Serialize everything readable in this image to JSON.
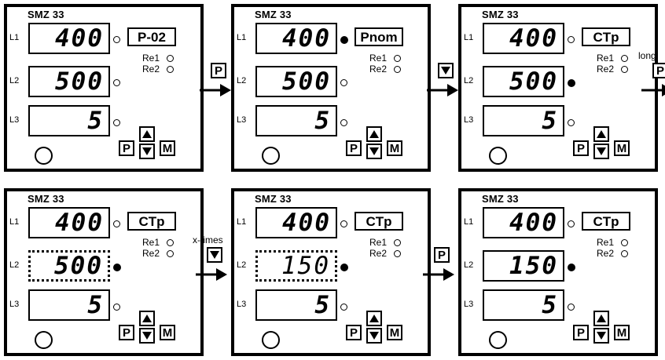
{
  "panels": [
    {
      "model": "SMZ 33",
      "rows": [
        {
          "label": "L1",
          "value": "400",
          "led": false
        },
        {
          "label": "L2",
          "value": "500",
          "led": false
        },
        {
          "label": "L3",
          "value": "5",
          "led": false
        }
      ],
      "param": "P-02",
      "relay1": "Re1",
      "relay2": "Re2",
      "keys": {
        "p": "P",
        "m": "M"
      }
    },
    {
      "model": "SMZ 33",
      "rows": [
        {
          "label": "L1",
          "value": "400",
          "led": true
        },
        {
          "label": "L2",
          "value": "500",
          "led": false
        },
        {
          "label": "L3",
          "value": "5",
          "led": false
        }
      ],
      "param": "Pnom",
      "relay1": "Re1",
      "relay2": "Re2",
      "keys": {
        "p": "P",
        "m": "M"
      }
    },
    {
      "model": "SMZ 33",
      "rows": [
        {
          "label": "L1",
          "value": "400",
          "led": false
        },
        {
          "label": "L2",
          "value": "500",
          "led": true
        },
        {
          "label": "L3",
          "value": "5",
          "led": false
        }
      ],
      "param": "CTp",
      "relay1": "Re1",
      "relay2": "Re2",
      "keys": {
        "p": "P",
        "m": "M"
      }
    },
    {
      "model": "SMZ 33",
      "rows": [
        {
          "label": "L1",
          "value": "400",
          "led": false
        },
        {
          "label": "L2",
          "value": "500",
          "led": true,
          "editing": true
        },
        {
          "label": "L3",
          "value": "5",
          "led": false
        }
      ],
      "param": "CTp",
      "relay1": "Re1",
      "relay2": "Re2",
      "keys": {
        "p": "P",
        "m": "M"
      }
    },
    {
      "model": "SMZ 33",
      "rows": [
        {
          "label": "L1",
          "value": "400",
          "led": false
        },
        {
          "label": "L2",
          "value": "150",
          "led": true,
          "editing": true
        },
        {
          "label": "L3",
          "value": "5",
          "led": false
        }
      ],
      "param": "CTp",
      "relay1": "Re1",
      "relay2": "Re2",
      "keys": {
        "p": "P",
        "m": "M"
      }
    },
    {
      "model": "SMZ 33",
      "rows": [
        {
          "label": "L1",
          "value": "400",
          "led": false
        },
        {
          "label": "L2",
          "value": "150",
          "led": true
        },
        {
          "label": "L3",
          "value": "5",
          "led": false
        }
      ],
      "param": "CTp",
      "relay1": "Re1",
      "relay2": "Re2",
      "keys": {
        "p": "P",
        "m": "M"
      }
    }
  ],
  "transitions": [
    {
      "caption": "",
      "key": "P",
      "key_icon": "p-key"
    },
    {
      "caption": "",
      "key": "",
      "key_icon": "down-arrow-key"
    },
    {
      "caption": "long",
      "key": "P",
      "key_icon": "p-key"
    },
    {
      "caption": "x-times",
      "key": "",
      "key_icon": "down-arrow-key"
    },
    {
      "caption": "",
      "key": "P",
      "key_icon": "p-key"
    }
  ]
}
